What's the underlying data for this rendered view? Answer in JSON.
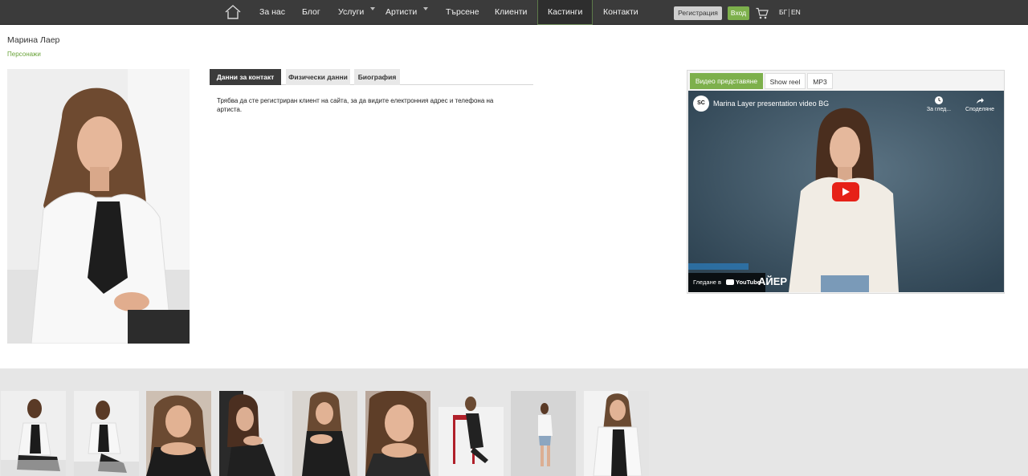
{
  "nav": {
    "items": [
      {
        "label": "За нас",
        "has_dropdown": false
      },
      {
        "label": "Блог",
        "has_dropdown": false
      },
      {
        "label": "Услуги",
        "has_dropdown": true
      },
      {
        "label": "Артисти",
        "has_dropdown": true
      },
      {
        "label": "Търсене",
        "has_dropdown": false
      },
      {
        "label": "Клиенти",
        "has_dropdown": false
      },
      {
        "label": "Кастинги",
        "has_dropdown": false,
        "active": true
      },
      {
        "label": "Контакти",
        "has_dropdown": false
      }
    ],
    "register_label": "Регистрация",
    "login_label": "Вход",
    "lang_bg": "БГ",
    "lang_en": "EN"
  },
  "page": {
    "title": "Марина Лаер",
    "breadcrumb": "Персонажи"
  },
  "tabs": [
    {
      "label": "Данни за контакт",
      "active": true
    },
    {
      "label": "Физически данни",
      "active": false
    },
    {
      "label": "Биография",
      "active": false
    }
  ],
  "tab_content": "Трябва да сте регистриран клиент на сайта, за да видите електронния адрес и телефона на артиста.",
  "video": {
    "tabs": [
      {
        "label": "Видео представяне",
        "active": true
      },
      {
        "label": "Show reel",
        "active": false
      },
      {
        "label": "MP3",
        "active": false
      }
    ],
    "title": "Marina Layer presentation video BG",
    "watch_later": "За глед...",
    "share": "Споделяне",
    "watch_on": "Гледане в",
    "youtube": "YouTube",
    "overlay_text": "АЙЕР"
  },
  "colors": {
    "nav_bg": "#3b3b3b",
    "accent_green": "#7db04c",
    "link_green": "#6aa33a",
    "gallery_bg": "#e6e6e6"
  },
  "gallery_count": 9
}
